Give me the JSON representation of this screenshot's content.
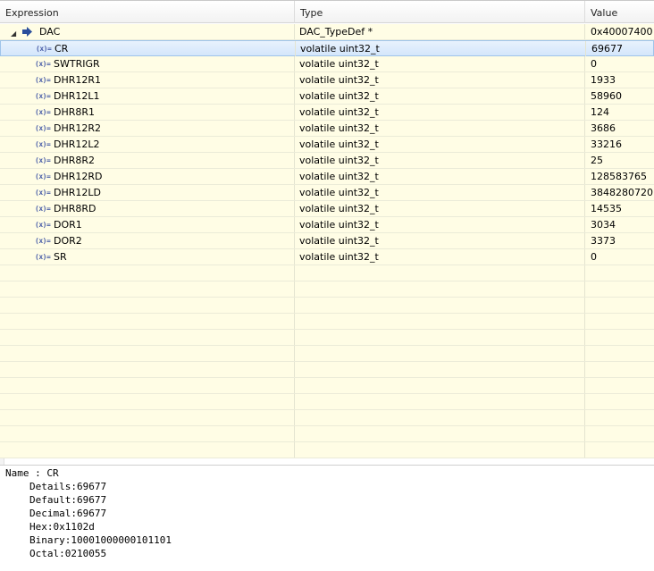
{
  "columns": {
    "expression": "Expression",
    "type": "Type",
    "value": "Value"
  },
  "root": {
    "name": "DAC",
    "type": "DAC_TypeDef *",
    "value": "0x40007400"
  },
  "var_icon_text": "(x)=",
  "rows": [
    {
      "name": "CR",
      "type": "volatile uint32_t",
      "value": "69677"
    },
    {
      "name": "SWTRIGR",
      "type": "volatile uint32_t",
      "value": "0"
    },
    {
      "name": "DHR12R1",
      "type": "volatile uint32_t",
      "value": "1933"
    },
    {
      "name": "DHR12L1",
      "type": "volatile uint32_t",
      "value": "58960"
    },
    {
      "name": "DHR8R1",
      "type": "volatile uint32_t",
      "value": "124"
    },
    {
      "name": "DHR12R2",
      "type": "volatile uint32_t",
      "value": "3686"
    },
    {
      "name": "DHR12L2",
      "type": "volatile uint32_t",
      "value": "33216"
    },
    {
      "name": "DHR8R2",
      "type": "volatile uint32_t",
      "value": "25"
    },
    {
      "name": "DHR12RD",
      "type": "volatile uint32_t",
      "value": "128583765"
    },
    {
      "name": "DHR12LD",
      "type": "volatile uint32_t",
      "value": "3848280720"
    },
    {
      "name": "DHR8RD",
      "type": "volatile uint32_t",
      "value": "14535"
    },
    {
      "name": "DOR1",
      "type": "volatile uint32_t",
      "value": "3034"
    },
    {
      "name": "DOR2",
      "type": "volatile uint32_t",
      "value": "3373"
    },
    {
      "name": "SR",
      "type": "volatile uint32_t",
      "value": "0"
    }
  ],
  "selected_row": 0,
  "empty_rows": 12,
  "details": {
    "name": "Name : CR",
    "lines": [
      "Details:69677",
      "Default:69677",
      "Decimal:69677",
      "Hex:0x1102d",
      "Binary:10001000000101101",
      "Octal:0210055"
    ]
  },
  "colors": {
    "row_bg": "#fffde5",
    "selected_bg": "#d4e6fb",
    "arrow": "#2a4e9c"
  }
}
